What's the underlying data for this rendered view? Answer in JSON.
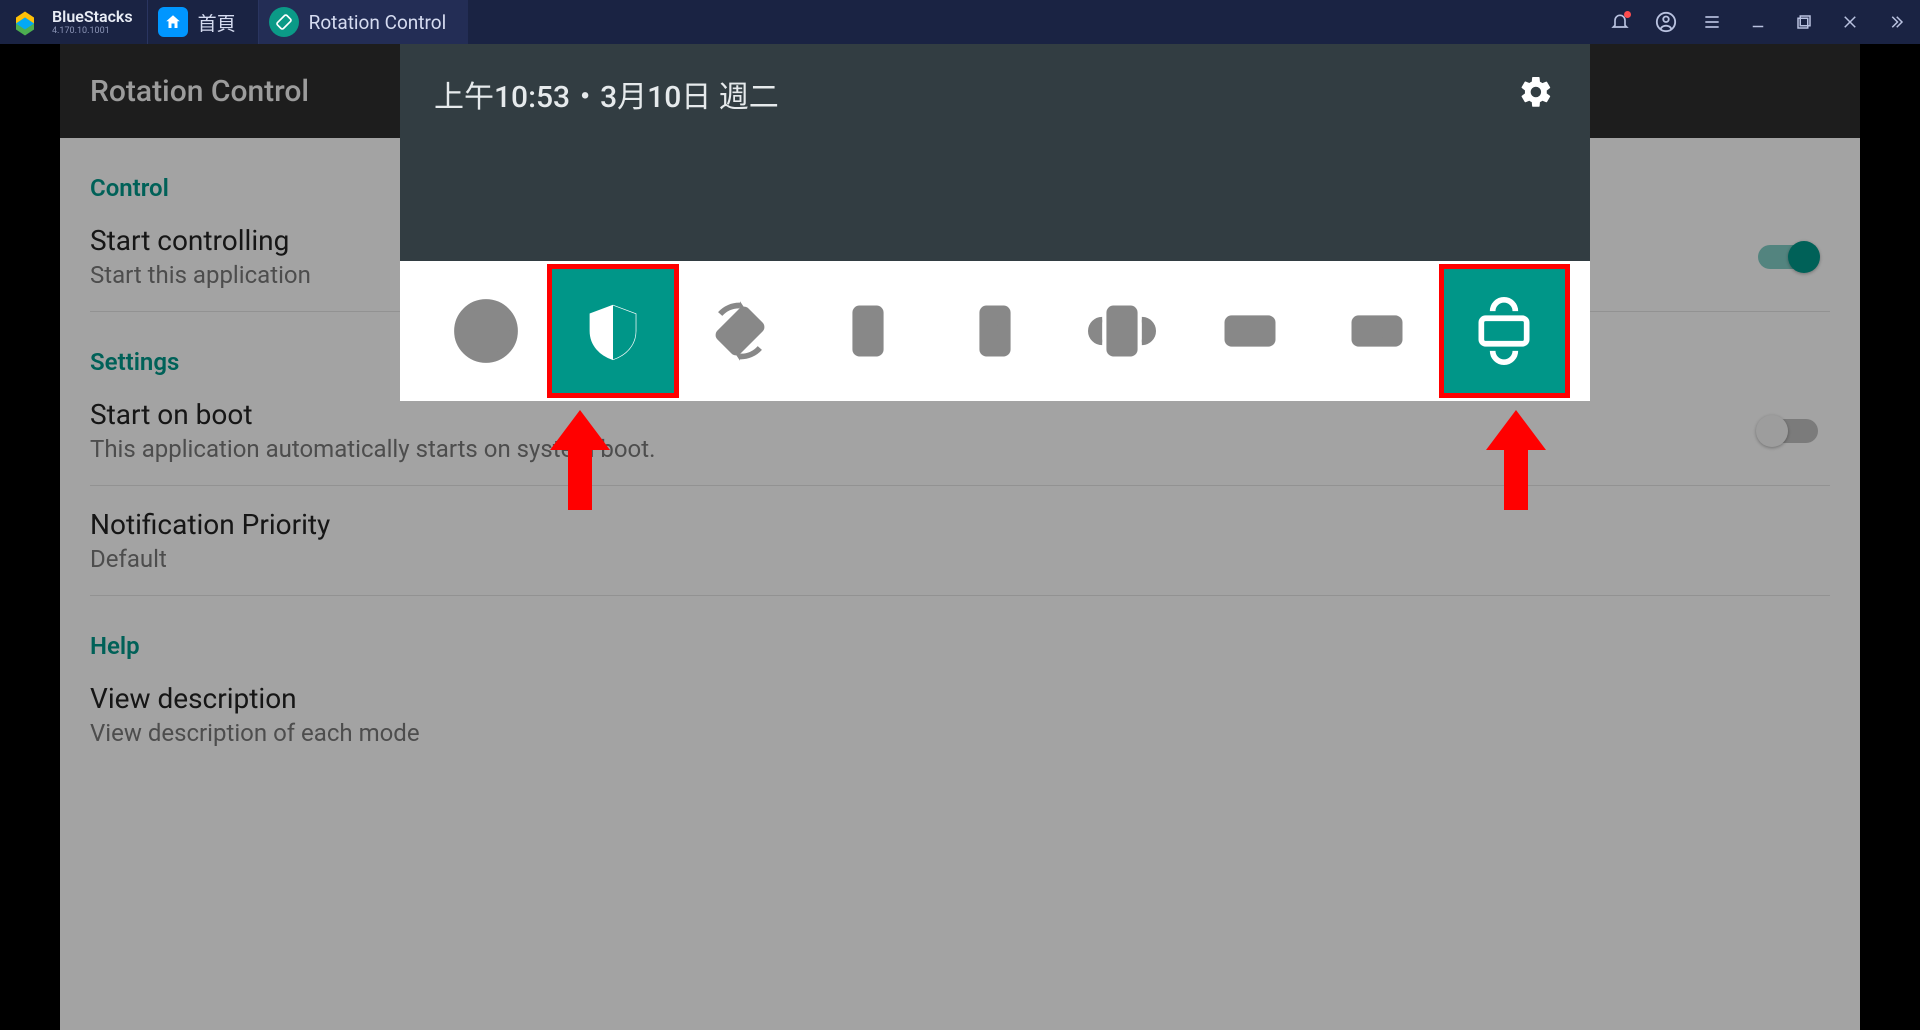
{
  "titlebar": {
    "brand": "BlueStacks",
    "version": "4.170.10.1001",
    "tabs": [
      {
        "label": "首頁",
        "icon": "home"
      },
      {
        "label": "Rotation Control",
        "icon": "rotation"
      }
    ]
  },
  "shade": {
    "time_date": "上午10:53・3月10日 週二",
    "modes": [
      {
        "name": "auto-rotate",
        "active": false,
        "highlighted": false
      },
      {
        "name": "guard",
        "active": true,
        "highlighted": true
      },
      {
        "name": "auto-rotate-alt",
        "active": false,
        "highlighted": false
      },
      {
        "name": "portrait",
        "active": false,
        "highlighted": false
      },
      {
        "name": "portrait-reverse",
        "active": false,
        "highlighted": false
      },
      {
        "name": "portrait-sensor",
        "active": false,
        "highlighted": false
      },
      {
        "name": "landscape",
        "active": false,
        "highlighted": false
      },
      {
        "name": "landscape-reverse",
        "active": false,
        "highlighted": false
      },
      {
        "name": "landscape-sensor",
        "active": true,
        "highlighted": true
      }
    ]
  },
  "app": {
    "title": "Rotation Control",
    "sections": {
      "control": {
        "label": "Control",
        "start_title": "Start controlling",
        "start_sub": "Start this application",
        "start_on": true
      },
      "settings": {
        "label": "Settings",
        "boot_title": "Start on boot",
        "boot_sub": "This application automatically starts on system boot.",
        "boot_on": false,
        "notif_title": "Notification Priority",
        "notif_sub": "Default"
      },
      "help": {
        "label": "Help",
        "view_title": "View description",
        "view_sub": "View description of each mode"
      }
    }
  },
  "colors": {
    "accent": "#009688",
    "highlight": "#ff0000"
  }
}
